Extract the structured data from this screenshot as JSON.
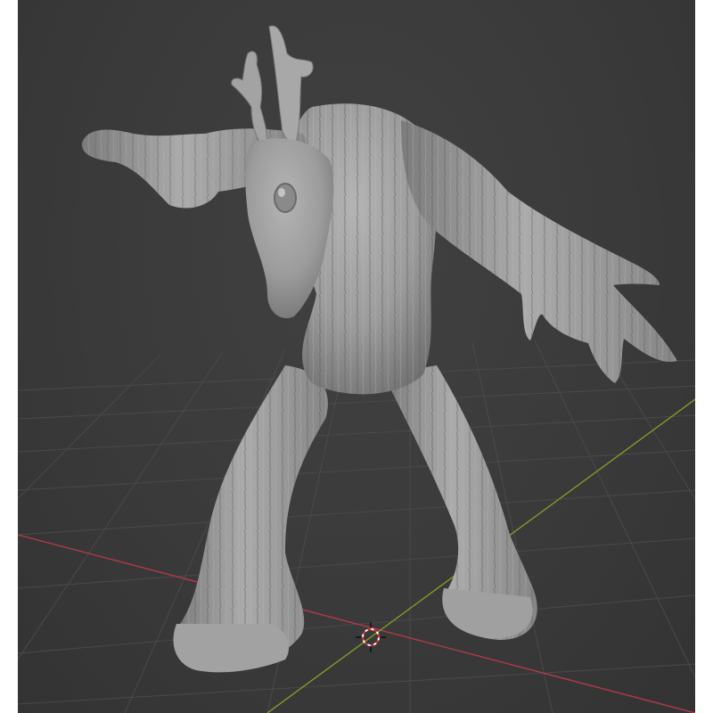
{
  "viewport": {
    "name": "3D Viewport",
    "background_color": "#3a3a3a",
    "grid_color": "#4a4a4a",
    "x_axis_color": "#b03a48",
    "y_axis_color": "#7f9a2a"
  },
  "scene": {
    "object": {
      "name": "tree-creature-sculpt",
      "material_color": "#9a9a9a",
      "shading": "solid"
    },
    "cursor": {
      "name": "3d-cursor",
      "ring_colors": [
        "#d83030",
        "#ffffff"
      ]
    }
  }
}
